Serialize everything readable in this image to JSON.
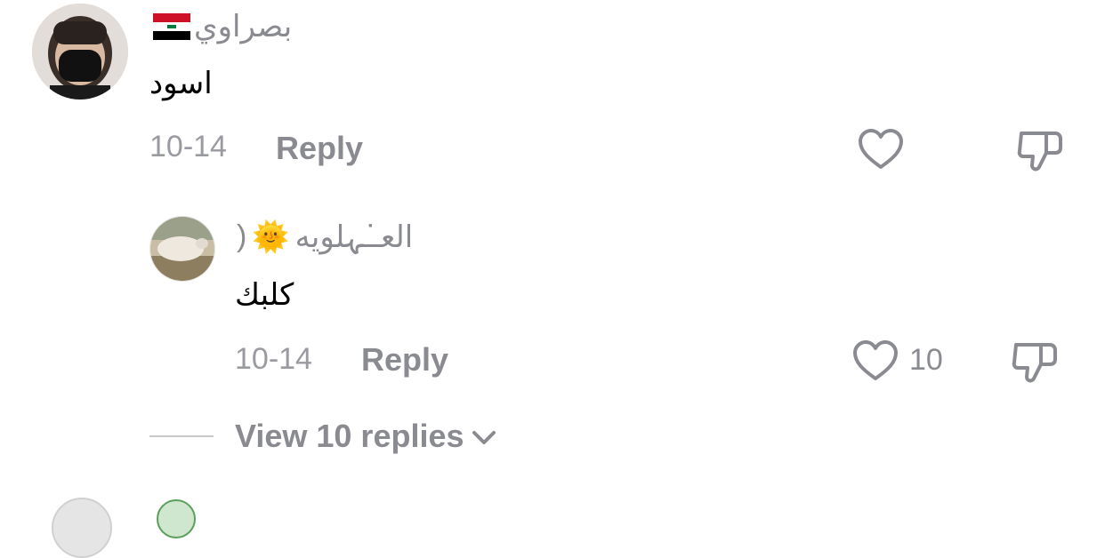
{
  "comment": {
    "username": "بصراوي",
    "flag_emoji": "🇮🇶",
    "text": "اسود",
    "date": "10-14",
    "reply_label": "Reply",
    "avatar_icon": "masked-person-avatar",
    "like_icon": "heart-outline-icon",
    "dislike_icon": "thumbs-down-icon"
  },
  "reply": {
    "username": "العـ͘ـہلويه",
    "emoji": "🌞",
    "trailing": ")",
    "text": "كلبك",
    "date": "10-14",
    "reply_label": "Reply",
    "like_count": "10",
    "avatar_icon": "sheep-avatar",
    "like_icon": "heart-outline-icon",
    "dislike_icon": "thumbs-down-icon"
  },
  "thread": {
    "view_replies_label": "View 10 replies",
    "chevron_icon": "chevron-down-icon"
  },
  "colors": {
    "muted_text": "#8a8b91",
    "icon_stroke": "#8a8b91",
    "body_text": "#000000"
  }
}
